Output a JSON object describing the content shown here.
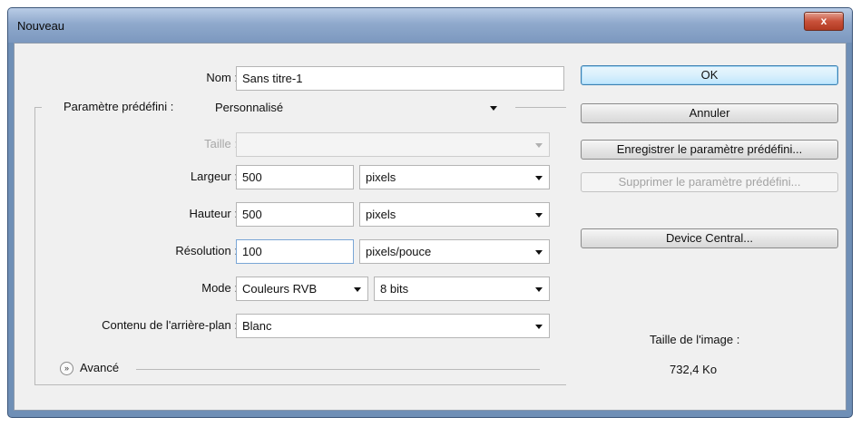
{
  "dialog": {
    "title": "Nouveau",
    "close_label": "x"
  },
  "form": {
    "name_label": "Nom :",
    "name_value": "Sans titre-1",
    "preset_label": "Paramètre prédéfini :",
    "preset_value": "Personnalisé",
    "size_label": "Taille :",
    "size_value": "",
    "width_label": "Largeur :",
    "width_value": "500",
    "width_unit": "pixels",
    "height_label": "Hauteur :",
    "height_value": "500",
    "height_unit": "pixels",
    "resolution_label": "Résolution :",
    "resolution_value": "100",
    "resolution_unit": "pixels/pouce",
    "mode_label": "Mode :",
    "mode_value": "Couleurs RVB",
    "depth_value": "8 bits",
    "background_label": "Contenu de l'arrière-plan :",
    "background_value": "Blanc",
    "advanced_label": "Avancé",
    "advanced_icon": "double-chevron-down-icon"
  },
  "buttons": {
    "ok": "OK",
    "cancel": "Annuler",
    "save_preset": "Enregistrer le paramètre prédéfini...",
    "delete_preset": "Supprimer le paramètre prédéfini...",
    "device_central": "Device Central..."
  },
  "info": {
    "image_size_label": "Taille de l'image :",
    "image_size_value": "732,4 Ko"
  },
  "colors": {
    "window_frame": "#6f8fb6",
    "close_button": "#c8513a",
    "default_button_border": "#3c7fb1",
    "dialog_background": "#f0f0f0"
  }
}
